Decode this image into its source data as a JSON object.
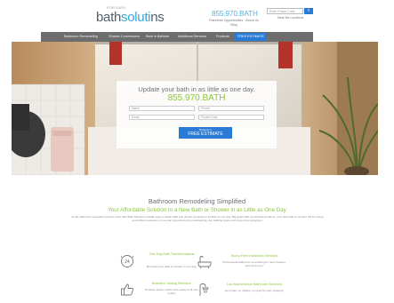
{
  "header": {
    "logo_tagline": "FOR EASY",
    "logo_main": "bath",
    "logo_accent": "soluti",
    "logo_end": "ns",
    "phone": "855.970.BATH",
    "links_line1": "Franchise Opportunities · About Us",
    "links_line2": "Blog",
    "zip_placeholder": "Enter Postal Code",
    "zip_button": "»",
    "locator": "Near Me Locations"
  },
  "nav": {
    "items": [
      "Bathroom Remodeling",
      "Shower Conversions",
      "Bath in Bathtub",
      "Additional Services",
      "Products"
    ],
    "cta": "FREE ESTIMATE"
  },
  "hero": {
    "headline": "Update your bath in as little as one day.",
    "phone": "855.970.BATH",
    "fields": {
      "name": "Name",
      "phone": "Phone",
      "email": "Email",
      "postal": "Postal Code"
    },
    "cta_small": "Request a",
    "cta_big": "FREE ESTIMATE"
  },
  "section": {
    "title": "Bathroom Remodeling Simplified",
    "subtitle": "Your Affordable Solution to a New Bath or Shower in as Little as One Day",
    "body": "At the bathroom renovation experts, Five Star Bath Solutions installs easy-to-clean bath and shower products in as little as one day. Big goals with economical products, your new bath or shower will be robust and mildew resistant, so you can spend less time maintaining your bathing space and more time enjoying it."
  },
  "features": [
    {
      "icon": "clock-24-icon",
      "title": "One-Day Bath Transformations",
      "text": "Remodel your bath or shower in one day."
    },
    {
      "icon": "bathtub-icon",
      "title": "Worry-Free Installation Services",
      "text": "Professional bathroom remodeling for new showers, tubs and more."
    },
    {
      "icon": "thumbs-up-icon",
      "title": "Beautiful Catalog Selection",
      "text": "Timeless styles, colors and variety to fit your needs."
    },
    {
      "icon": "shower-icon",
      "title": "Low-Maintenance Bathroom Solutions",
      "text": "No mould, no mildew, so good for easy cleaning."
    }
  ],
  "colors": {
    "accent_blue": "#2a7bd6",
    "accent_green": "#8cc43f",
    "nav_gray": "#6d6d6d"
  }
}
